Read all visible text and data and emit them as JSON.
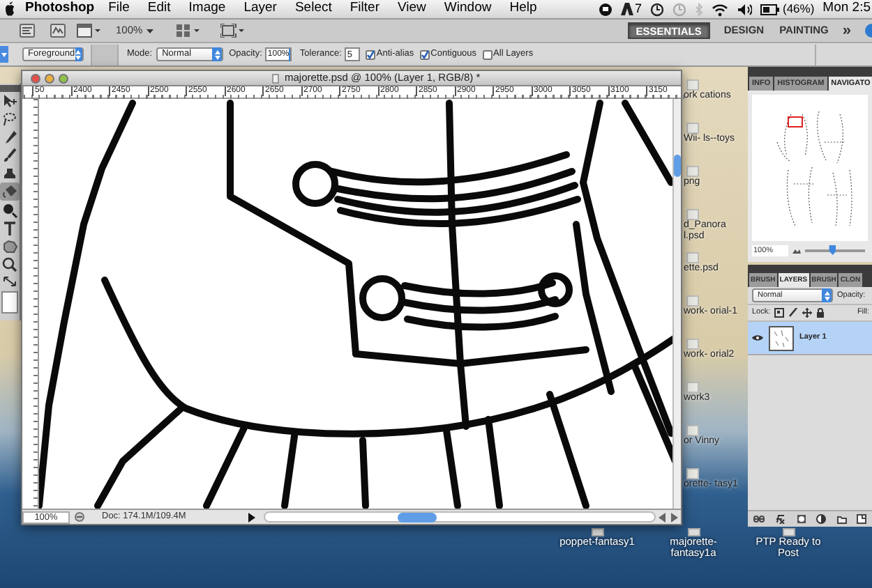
{
  "menubar": {
    "app": "Photoshop",
    "items": [
      "File",
      "Edit",
      "Image",
      "Layer",
      "Select",
      "Filter",
      "View",
      "Window",
      "Help"
    ],
    "adobe_count": "7",
    "battery": "(46%)",
    "clock": "Mon 2:5"
  },
  "appbar": {
    "zoom": "100%",
    "workspaces": [
      {
        "label": "ESSENTIALS",
        "selected": true
      },
      {
        "label": "DESIGN",
        "selected": false
      },
      {
        "label": "PAINTING",
        "selected": false
      }
    ],
    "more": "»"
  },
  "options": {
    "fill_source": "Foreground",
    "mode_label": "Mode:",
    "mode": "Normal",
    "opacity_label": "Opacity:",
    "opacity": "100%",
    "tolerance_label": "Tolerance:",
    "tolerance": "5",
    "checkboxes": [
      {
        "label": "Anti-alias",
        "checked": true
      },
      {
        "label": "Contiguous",
        "checked": true
      },
      {
        "label": "All Layers",
        "checked": false
      }
    ]
  },
  "tools": [
    {
      "kind": "move",
      "selected": false
    },
    {
      "kind": "lasso",
      "selected": false
    },
    {
      "kind": "eyedropper",
      "selected": false
    },
    {
      "kind": "brush",
      "selected": false
    },
    {
      "kind": "stamp",
      "selected": false
    },
    {
      "kind": "bucket",
      "selected": true
    },
    {
      "kind": "dodge",
      "selected": false
    },
    {
      "kind": "type",
      "selected": false
    },
    {
      "kind": "shape",
      "selected": false
    },
    {
      "kind": "zoom",
      "selected": false
    }
  ],
  "document": {
    "title": "majorette.psd @ 100% (Layer 1, RGB/8) *",
    "ruler_labels": [
      "50",
      "2400",
      "2450",
      "2500",
      "2550",
      "2600",
      "2650",
      "2700",
      "2750",
      "2800",
      "2850",
      "2900",
      "2950",
      "3000",
      "3050",
      "3100",
      "3150"
    ],
    "zoom": "100%",
    "doc_info": "Doc: 174.1M/109.4M"
  },
  "desktop_icons": [
    {
      "label": "ork cations"
    },
    {
      "label": "Wii- ls--toys"
    },
    {
      "label": "png"
    },
    {
      "label": "d_Panora l.psd"
    },
    {
      "label": "ette.psd"
    },
    {
      "label": "work- orial-1"
    },
    {
      "label": "work- orial2"
    },
    {
      "label": "work3"
    },
    {
      "label": "or Vinny"
    },
    {
      "label": "orette- tasy1"
    }
  ],
  "desktop_bottom_icons": [
    {
      "label": "poppet-fantasy1"
    },
    {
      "label": "majorette-fantasy1a"
    },
    {
      "label": "PTP Ready to Post"
    }
  ],
  "navigator": {
    "tabs": [
      {
        "label": "INFO",
        "selected": false
      },
      {
        "label": "HISTOGRAM",
        "selected": false
      },
      {
        "label": "NAVIGATO",
        "selected": true
      }
    ],
    "zoom": "100%",
    "level": 0.45
  },
  "layers": {
    "tabs": [
      {
        "label": "BRUSH",
        "selected": false
      },
      {
        "label": "LAYERS",
        "selected": true
      },
      {
        "label": "BRUSH",
        "selected": false
      },
      {
        "label": "CLON",
        "selected": false
      }
    ],
    "blend_mode": "Normal",
    "opacity_label": "Opacity:",
    "lock_label": "Lock:",
    "fill_label": "Fill:",
    "items": [
      {
        "name": "Layer 1",
        "selected": true,
        "visible": true
      }
    ]
  }
}
